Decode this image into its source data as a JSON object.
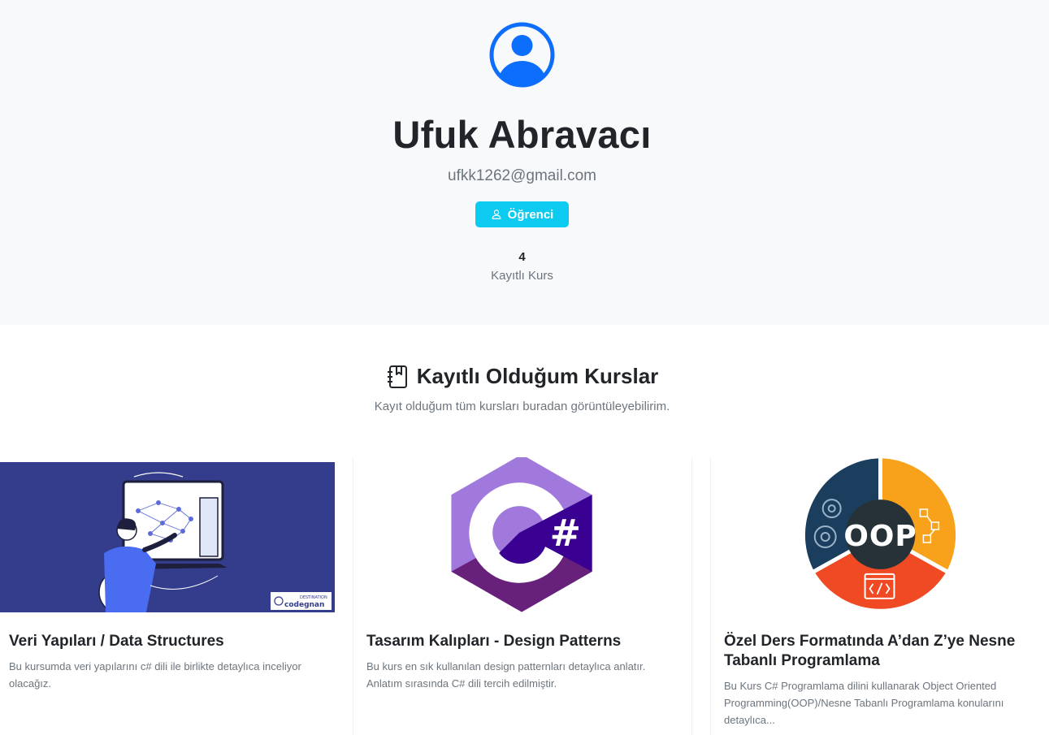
{
  "profile": {
    "name": "Ufuk Abravacı",
    "email": "ufkk1262@gmail.com",
    "role": "Öğrenci",
    "role_icon": "user-icon",
    "stats": {
      "value": "4",
      "label": "Kayıtlı Kurs"
    }
  },
  "section": {
    "title": "Kayıtlı Olduğum Kurslar",
    "icon": "journal-bookmark-icon",
    "subtitle": "Kayıt olduğum tüm kursları buradan görüntüleyebilirim."
  },
  "courses": [
    {
      "title": "Veri Yapıları / Data Structures",
      "description": "Bu kursumda veri yapılarını c# dili ile birlikte detaylıca inceliyor olacağız.",
      "badge_top": "DESTINATION",
      "badge_bottom": "codegnan"
    },
    {
      "title": "Tasarım Kalıpları - Design Patterns",
      "description": "Bu kurs en sık kullanılan design patternları detaylıca anlatır. Anlatım sırasında C# dili tercih edilmiştir.",
      "image_text": "#"
    },
    {
      "title": "Özel Ders Formatında A’dan Z’ye Nesne Tabanlı Programlama",
      "description": "Bu Kurs C# Programlama dilini kullanarak Object Oriented Programming(OOP)/Nesne Tabanlı Programlama konularını detaylıca...",
      "image_text": "OOP"
    }
  ],
  "colors": {
    "accent": "#0d6efd",
    "badge": "#0dcaf0",
    "header_bg": "#f8f9fa",
    "ds_image_bg": "#343c8c",
    "csharp_light": "#a179dc",
    "csharp_dark": "#390091",
    "oop_blue": "#1b3e5e",
    "oop_orange": "#f8a21c",
    "oop_red": "#f04a24"
  }
}
